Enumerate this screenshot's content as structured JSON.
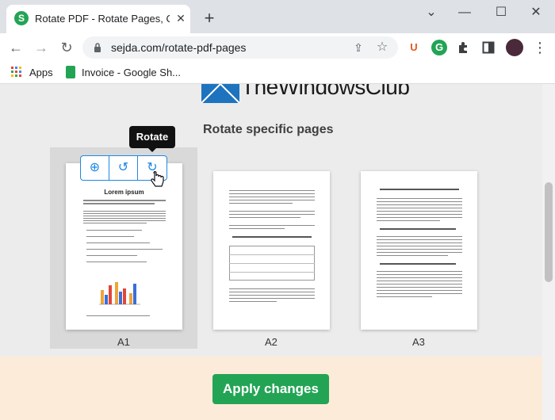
{
  "browser": {
    "tab_title": "Rotate PDF - Rotate Pages, Onlin",
    "tab_favicon_letter": "S",
    "tab_close": "✕",
    "new_tab": "+",
    "url": "sejda.com/rotate-pdf-pages",
    "window_controls": {
      "minimize": "—",
      "maximize": "☐",
      "close": "✕",
      "collapse": "⌄"
    },
    "extensions": {
      "ublock": "U",
      "grammarly": "G"
    }
  },
  "bookmarks": {
    "apps_label": "Apps",
    "invoice_label": "Invoice - Google Sh..."
  },
  "watermark": {
    "text": "TheWindowsClub"
  },
  "main": {
    "section_title": "Rotate specific pages",
    "tooltip": "Rotate",
    "pages": [
      {
        "label": "A1",
        "heading": "Lorem ipsum"
      },
      {
        "label": "A2"
      },
      {
        "label": "A3"
      }
    ],
    "apply_label": "Apply changes"
  },
  "colors": {
    "accent_green": "#23a455",
    "tool_blue": "#1e88e5",
    "footer_bg": "#fcebd8"
  },
  "icons": [
    "zoom-in-icon",
    "rotate-left-icon",
    "rotate-right-icon",
    "hand-cursor-icon",
    "lock-icon",
    "share-icon",
    "star-icon",
    "puzzle-icon",
    "sidebar-icon"
  ]
}
